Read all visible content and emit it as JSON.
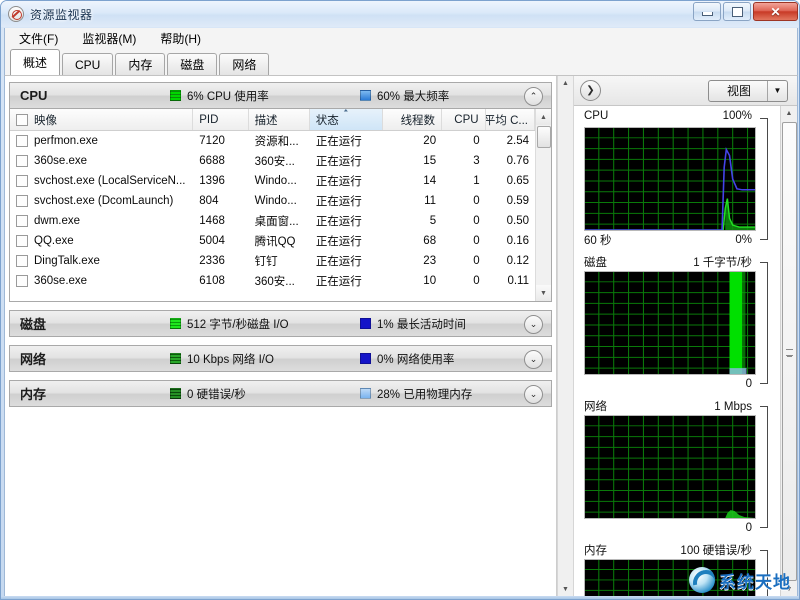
{
  "window": {
    "title": "资源监视器",
    "icon": "resource-monitor-icon",
    "buttons": {
      "minimize": "",
      "maximize": "",
      "close": "✕"
    }
  },
  "menu": {
    "items": [
      {
        "label": "文件(F)"
      },
      {
        "label": "监视器(M)"
      },
      {
        "label": "帮助(H)"
      }
    ]
  },
  "tabs": [
    {
      "label": "概述",
      "active": true
    },
    {
      "label": "CPU",
      "active": false
    },
    {
      "label": "内存",
      "active": false
    },
    {
      "label": "磁盘",
      "active": false
    },
    {
      "label": "网络",
      "active": false
    }
  ],
  "sections": {
    "cpu": {
      "title": "CPU",
      "stat1": {
        "text": "6% CPU 使用率",
        "color": "#00d600"
      },
      "stat2": {
        "text": "60% 最大频率",
        "color": "#3c8fe8"
      },
      "chevron": "⌃",
      "expanded": true
    },
    "disk": {
      "title": "磁盘",
      "stat1": {
        "text": "512 字节/秒磁盘 I/O",
        "color": "#1fe61f"
      },
      "stat2": {
        "text": "1% 最长活动时间",
        "color": "#1414c8"
      },
      "chevron": "⌄",
      "expanded": false
    },
    "network": {
      "title": "网络",
      "stat1": {
        "text": "10 Kbps 网络 I/O",
        "color": "#1a7a1a"
      },
      "stat2": {
        "text": "0% 网络使用率",
        "color": "#1414c8"
      },
      "chevron": "⌄",
      "expanded": false
    },
    "memory": {
      "title": "内存",
      "stat1": {
        "text": "0 硬错误/秒",
        "color": "#1a6a1a"
      },
      "stat2": {
        "text": "28% 已用物理内存",
        "color": "#7ab4f0"
      },
      "chevron": "⌄",
      "expanded": false
    }
  },
  "process_table": {
    "columns": [
      {
        "key": "image",
        "label": "映像",
        "align": "left"
      },
      {
        "key": "pid",
        "label": "PID",
        "align": "left"
      },
      {
        "key": "desc",
        "label": "描述",
        "align": "left"
      },
      {
        "key": "state",
        "label": "状态",
        "align": "left",
        "sorted": true
      },
      {
        "key": "threads",
        "label": "线程数",
        "align": "right"
      },
      {
        "key": "cpu",
        "label": "CPU",
        "align": "right"
      },
      {
        "key": "avgcpu",
        "label": "平均 C...",
        "align": "right"
      }
    ],
    "rows": [
      {
        "image": "perfmon.exe",
        "pid": "7120",
        "desc": "资源和...",
        "state": "正在运行",
        "threads": "20",
        "cpu": "0",
        "avgcpu": "2.54"
      },
      {
        "image": "360se.exe",
        "pid": "6688",
        "desc": "360安...",
        "state": "正在运行",
        "threads": "15",
        "cpu": "3",
        "avgcpu": "0.76"
      },
      {
        "image": "svchost.exe (LocalServiceN...",
        "pid": "1396",
        "desc": "Windo...",
        "state": "正在运行",
        "threads": "14",
        "cpu": "1",
        "avgcpu": "0.65"
      },
      {
        "image": "svchost.exe (DcomLaunch)",
        "pid": "804",
        "desc": "Windo...",
        "state": "正在运行",
        "threads": "11",
        "cpu": "0",
        "avgcpu": "0.59"
      },
      {
        "image": "dwm.exe",
        "pid": "1468",
        "desc": "桌面窗...",
        "state": "正在运行",
        "threads": "5",
        "cpu": "0",
        "avgcpu": "0.50"
      },
      {
        "image": "QQ.exe",
        "pid": "5004",
        "desc": "腾讯QQ",
        "state": "正在运行",
        "threads": "68",
        "cpu": "0",
        "avgcpu": "0.16"
      },
      {
        "image": "DingTalk.exe",
        "pid": "2336",
        "desc": "钉钉",
        "state": "正在运行",
        "threads": "23",
        "cpu": "0",
        "avgcpu": "0.12"
      },
      {
        "image": "360se.exe",
        "pid": "6108",
        "desc": "360安...",
        "state": "正在运行",
        "threads": "10",
        "cpu": "0",
        "avgcpu": "0.11"
      }
    ]
  },
  "right_panel": {
    "collapse_icon": "❯",
    "view_button": {
      "label": "视图",
      "arrow": "▼"
    },
    "graphs": [
      {
        "name": "cpu-graph",
        "title": "CPU",
        "scale_top": "100%",
        "scale_bottom": "0%",
        "footer_left": "60 秒",
        "series": [
          {
            "name": "最大频率",
            "color": "#3030d0",
            "type": "line"
          },
          {
            "name": "CPU 使用率",
            "color": "#00c000",
            "type": "area"
          }
        ]
      },
      {
        "name": "disk-graph",
        "title": "磁盘",
        "scale_top": "1 千字节/秒",
        "scale_bottom": "0",
        "footer_left": "",
        "series": [
          {
            "name": "磁盘 I/O",
            "color": "#00e000",
            "type": "area"
          }
        ]
      },
      {
        "name": "network-graph",
        "title": "网络",
        "scale_top": "1 Mbps",
        "scale_bottom": "0",
        "footer_left": "",
        "series": [
          {
            "name": "网络 I/O",
            "color": "#00c000",
            "type": "area"
          }
        ]
      },
      {
        "name": "memory-graph",
        "title": "内存",
        "scale_top": "100 硬错误/秒",
        "scale_bottom": "",
        "footer_left": "",
        "series": [
          {
            "name": "硬错误/秒",
            "color": "#00c000",
            "type": "area"
          }
        ]
      }
    ]
  },
  "watermark": {
    "text": "系统天地",
    "color": "#1b6fc0"
  },
  "chart_data": [
    {
      "type": "line",
      "name": "CPU",
      "title": "CPU",
      "ylim": [
        0,
        100
      ],
      "ylabel": "%",
      "xlabel": "60 秒",
      "grid": true,
      "series": [
        {
          "name": "最大频率",
          "color": "#3030d0",
          "values": [
            0,
            0,
            0,
            0,
            0,
            0,
            0,
            0,
            0,
            0,
            0,
            0,
            0,
            0,
            0,
            0,
            0,
            0,
            0,
            0,
            0,
            0,
            0,
            0,
            0,
            0,
            0,
            0,
            0,
            0,
            0,
            0,
            0,
            0,
            0,
            0,
            0,
            0,
            0,
            0,
            0,
            0,
            0,
            0,
            0,
            0,
            0,
            0,
            0,
            0,
            0,
            78,
            74,
            60,
            48,
            44,
            42,
            42,
            42,
            42
          ]
        },
        {
          "name": "CPU 使用率",
          "color": "#00c000",
          "values": [
            0,
            0,
            0,
            0,
            0,
            0,
            0,
            0,
            0,
            0,
            0,
            0,
            0,
            0,
            0,
            0,
            0,
            0,
            0,
            0,
            0,
            0,
            0,
            0,
            0,
            0,
            0,
            0,
            0,
            0,
            0,
            0,
            0,
            0,
            0,
            0,
            0,
            0,
            0,
            0,
            0,
            0,
            0,
            0,
            0,
            0,
            0,
            0,
            0,
            0,
            0,
            22,
            12,
            5,
            3,
            6,
            4,
            3,
            4,
            6
          ]
        }
      ]
    },
    {
      "type": "area",
      "name": "磁盘",
      "title": "磁盘",
      "ylim": [
        0,
        1
      ],
      "ylabel": "千字节/秒",
      "grid": true,
      "series": [
        {
          "name": "磁盘 I/O",
          "color": "#00e000",
          "values": [
            0,
            0,
            0,
            0,
            0,
            0,
            0,
            0,
            0,
            0,
            0,
            0,
            0,
            0,
            0,
            0,
            0,
            0,
            0,
            0,
            0,
            0,
            0,
            0,
            0,
            0,
            0,
            0,
            0,
            0,
            0,
            0,
            0,
            0,
            0,
            0,
            0,
            0,
            0,
            0,
            0,
            0,
            0,
            0,
            0,
            0,
            0,
            0,
            0,
            0,
            0,
            0,
            0,
            1,
            1,
            1,
            1,
            1,
            1,
            1
          ]
        }
      ]
    },
    {
      "type": "area",
      "name": "网络",
      "title": "网络",
      "ylim": [
        0,
        1
      ],
      "ylabel": "Mbps",
      "grid": true,
      "series": [
        {
          "name": "网络 I/O",
          "color": "#00c000",
          "values": [
            0,
            0,
            0,
            0,
            0,
            0,
            0,
            0,
            0,
            0,
            0,
            0,
            0,
            0,
            0,
            0,
            0,
            0,
            0,
            0,
            0,
            0,
            0,
            0,
            0,
            0,
            0,
            0,
            0,
            0,
            0,
            0,
            0,
            0,
            0,
            0,
            0,
            0,
            0,
            0,
            0,
            0,
            0,
            0,
            0,
            0,
            0,
            0,
            0,
            0,
            0,
            0,
            0,
            0,
            0,
            0.03,
            0.05,
            0.04,
            0.02,
            0.01
          ]
        }
      ]
    },
    {
      "type": "area",
      "name": "内存",
      "title": "内存",
      "ylim": [
        0,
        100
      ],
      "ylabel": "硬错误/秒",
      "grid": true,
      "series": [
        {
          "name": "硬错误/秒",
          "color": "#00c000",
          "values": [
            0,
            0,
            0,
            0,
            0,
            0,
            0,
            0,
            0,
            0,
            0,
            0,
            0,
            0,
            0,
            0,
            0,
            0,
            0,
            0,
            0,
            0,
            0,
            0,
            0,
            0,
            0,
            0,
            0,
            0,
            0,
            0,
            0,
            0,
            0,
            0,
            0,
            0,
            0,
            0,
            0,
            0,
            0,
            0,
            0,
            0,
            0,
            0,
            0,
            0,
            0,
            0,
            0,
            0,
            0,
            0,
            0,
            0,
            0,
            0
          ]
        }
      ]
    }
  ]
}
